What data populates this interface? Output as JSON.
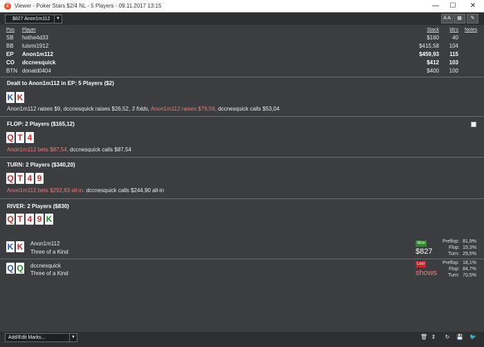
{
  "window": {
    "title": "Viewer - Poker Stars $2/4 NL - 5 Players - 09.11.2017 13:15",
    "app_icon": "Z",
    "minimize": "—",
    "maximize": "☐",
    "close": "✕"
  },
  "toolbar": {
    "hand_select_value": "$827 Anon1m112",
    "font_button": "A A",
    "grid_button": "▦",
    "edit_button": "✎"
  },
  "players_table": {
    "headers": {
      "pos": "Pos",
      "player": "Player",
      "stack": "Stack",
      "bbs": "bb's",
      "notes": "Notes"
    },
    "rows": [
      {
        "pos": "SB",
        "player": "hothe4d33",
        "stack": "$160",
        "bbs": "40"
      },
      {
        "pos": "BB",
        "player": "luismi1912",
        "stack": "$415,58",
        "bbs": "104"
      },
      {
        "pos": "EP",
        "player": "Anon1m112",
        "stack": "$459,93",
        "bbs": "115"
      },
      {
        "pos": "CO",
        "player": "dccnesquick",
        "stack": "$412",
        "bbs": "103"
      },
      {
        "pos": "BTN",
        "player": "donald0404",
        "stack": "$400",
        "bbs": "100"
      }
    ]
  },
  "colors": {
    "spade": "#2b4fc4",
    "heart": "#cf2b2b",
    "club": "#1e8c2e",
    "diamond": "#2b4fc4",
    "hero": "#e2807a",
    "won": "#2a8a2a",
    "lost": "#c42424"
  },
  "preflop": {
    "title": "Dealt to Anon1m112 in EP: 5 Players ($2)",
    "cards": [
      {
        "rank": "K",
        "suit": "spade"
      },
      {
        "rank": "K",
        "suit": "heart"
      }
    ],
    "actions": {
      "a1": "Anon1m112 raises $9, dccnesquick raises $26,52,",
      "a2": "3 folds,",
      "a3": "Anon1m112 raises $79,56,",
      "a4": "dccnesquick calls $53,04"
    }
  },
  "flop": {
    "title": "FLOP: 2 Players ($165,12)",
    "cards": [
      {
        "rank": "Q",
        "suit": "heart"
      },
      {
        "rank": "T",
        "suit": "heart"
      },
      {
        "rank": "4",
        "suit": "heart"
      }
    ],
    "actions": {
      "a1": "Anon1m112 bets $87,54,",
      "a2": "dccnesquick calls $87,54"
    }
  },
  "turn": {
    "title": "TURN: 2 Players ($340,20)",
    "cards": [
      {
        "rank": "Q",
        "suit": "heart"
      },
      {
        "rank": "T",
        "suit": "heart"
      },
      {
        "rank": "4",
        "suit": "heart"
      },
      {
        "rank": "9",
        "suit": "heart"
      }
    ],
    "actions": {
      "a1": "Anon1m112 bets $292,83 all-in.",
      "a2": "dccnesquick calls $244,90 all-in"
    }
  },
  "river": {
    "title": "RIVER: 2 Players ($830)",
    "cards": [
      {
        "rank": "Q",
        "suit": "heart"
      },
      {
        "rank": "T",
        "suit": "heart"
      },
      {
        "rank": "4",
        "suit": "heart"
      },
      {
        "rank": "9",
        "suit": "heart"
      },
      {
        "rank": "K",
        "suit": "club"
      }
    ]
  },
  "results": [
    {
      "player": "Anon1m112",
      "hand": "Three of a Kind",
      "cards": [
        {
          "rank": "K",
          "suit": "spade"
        },
        {
          "rank": "K",
          "suit": "heart"
        }
      ],
      "badge": "Won",
      "amount": "$827",
      "equity": {
        "preflop_label": "Preflop:",
        "preflop": "81,9%",
        "flop_label": "Flop:",
        "flop": "15,3%",
        "turn_label": "Turn:",
        "turn": "29,5%"
      }
    },
    {
      "player": "dccnesquick",
      "hand": "Three of a Kind",
      "cards": [
        {
          "rank": "Q",
          "suit": "diamond"
        },
        {
          "rank": "Q",
          "suit": "club"
        }
      ],
      "badge": "Lost",
      "amount": "shows",
      "equity": {
        "preflop_label": "Preflop:",
        "preflop": "18,1%",
        "flop_label": "Flop:",
        "flop": "84,7%",
        "turn_label": "Turn:",
        "turn": "70,5%"
      }
    }
  ],
  "bottombar": {
    "marks_placeholder": "Add/Edit Marks...",
    "btn_delete": "🗑",
    "btn_stepper": "⇕",
    "btn_replay": "↻",
    "btn_save": "💾",
    "btn_twitter": "🐦"
  }
}
